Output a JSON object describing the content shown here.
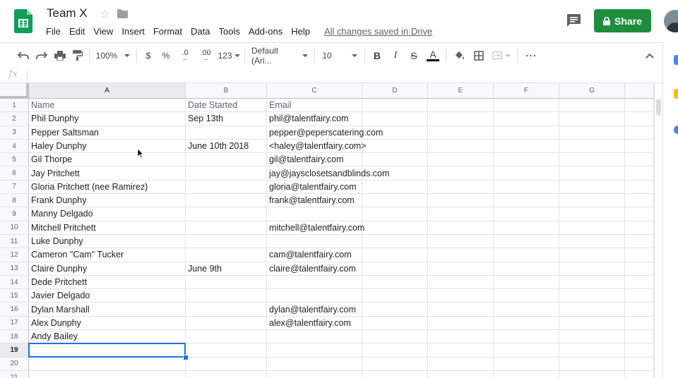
{
  "doc": {
    "title": "Team X",
    "saved_status": "All changes saved in Drive"
  },
  "menu": [
    "File",
    "Edit",
    "View",
    "Insert",
    "Format",
    "Data",
    "Tools",
    "Add-ons",
    "Help"
  ],
  "share": {
    "label": "Share"
  },
  "toolbar": {
    "zoom": "100%",
    "currency": "$",
    "percent": "%",
    "decrease_decimal": ".0",
    "increase_decimal": ".00",
    "more_formats": "123",
    "font": "Default (Ari...",
    "font_size": "10",
    "bold": "B",
    "italic": "I",
    "strikethrough": "S",
    "text_color_letter": "A"
  },
  "formula_bar": {
    "fx": "fx",
    "value": ""
  },
  "columns": [
    "A",
    "B",
    "C",
    "D",
    "E",
    "F",
    "G"
  ],
  "rows": [
    [
      "Name",
      "Date Started",
      "Email"
    ],
    [
      "Phil Dunphy",
      "Sep 13th",
      "phil@talentfairy.com"
    ],
    [
      "Pepper Saltsman",
      "",
      "pepper@peperscatering.com"
    ],
    [
      "Haley Dunphy",
      "June 10th 2018",
      "<haley@talentfairy.com>"
    ],
    [
      "Gil Thorpe",
      "",
      "gil@talentfairy.com"
    ],
    [
      "Jay Pritchett",
      "",
      "jay@jaysclosetsandblinds.com"
    ],
    [
      "Gloria Pritchett (nee Ramirez)",
      "",
      "gloria@talentfairy.com"
    ],
    [
      "Frank Dunphy",
      "",
      "frank@talentfairy.com"
    ],
    [
      "Manny Delgado",
      "",
      ""
    ],
    [
      "Mitchell Pritchett",
      "",
      "mitchell@talentfairy.com"
    ],
    [
      "Luke Dunphy",
      "",
      ""
    ],
    [
      "Cameron \"Cam\" Tucker",
      "",
      "cam@talentfairy.com"
    ],
    [
      "Claire Dunphy",
      "June 9th",
      "claire@talentfairy.com"
    ],
    [
      "Dede Pritchett",
      "",
      ""
    ],
    [
      "Javier Delgado",
      "",
      ""
    ],
    [
      "Dylan Marshall",
      "",
      "dylan@talentfairy.com"
    ],
    [
      "Alex Dunphy",
      "",
      "alex@talentfairy.com"
    ],
    [
      "Andy Bailey",
      "",
      ""
    ],
    [
      "",
      "",
      ""
    ],
    [
      "",
      "",
      ""
    ],
    [
      "",
      "",
      ""
    ]
  ],
  "row_numbers": [
    "1",
    "2",
    "3",
    "4",
    "5",
    "6",
    "7",
    "8",
    "9",
    "10",
    "11",
    "12",
    "13",
    "14",
    "15",
    "16",
    "17",
    "18",
    "19",
    "20",
    "21"
  ],
  "selected": {
    "row": 19,
    "col": "A"
  },
  "colors": {
    "share_green": "#1e8e3e",
    "selection_blue": "#1a73e8",
    "sheets_green": "#0f9d58"
  }
}
